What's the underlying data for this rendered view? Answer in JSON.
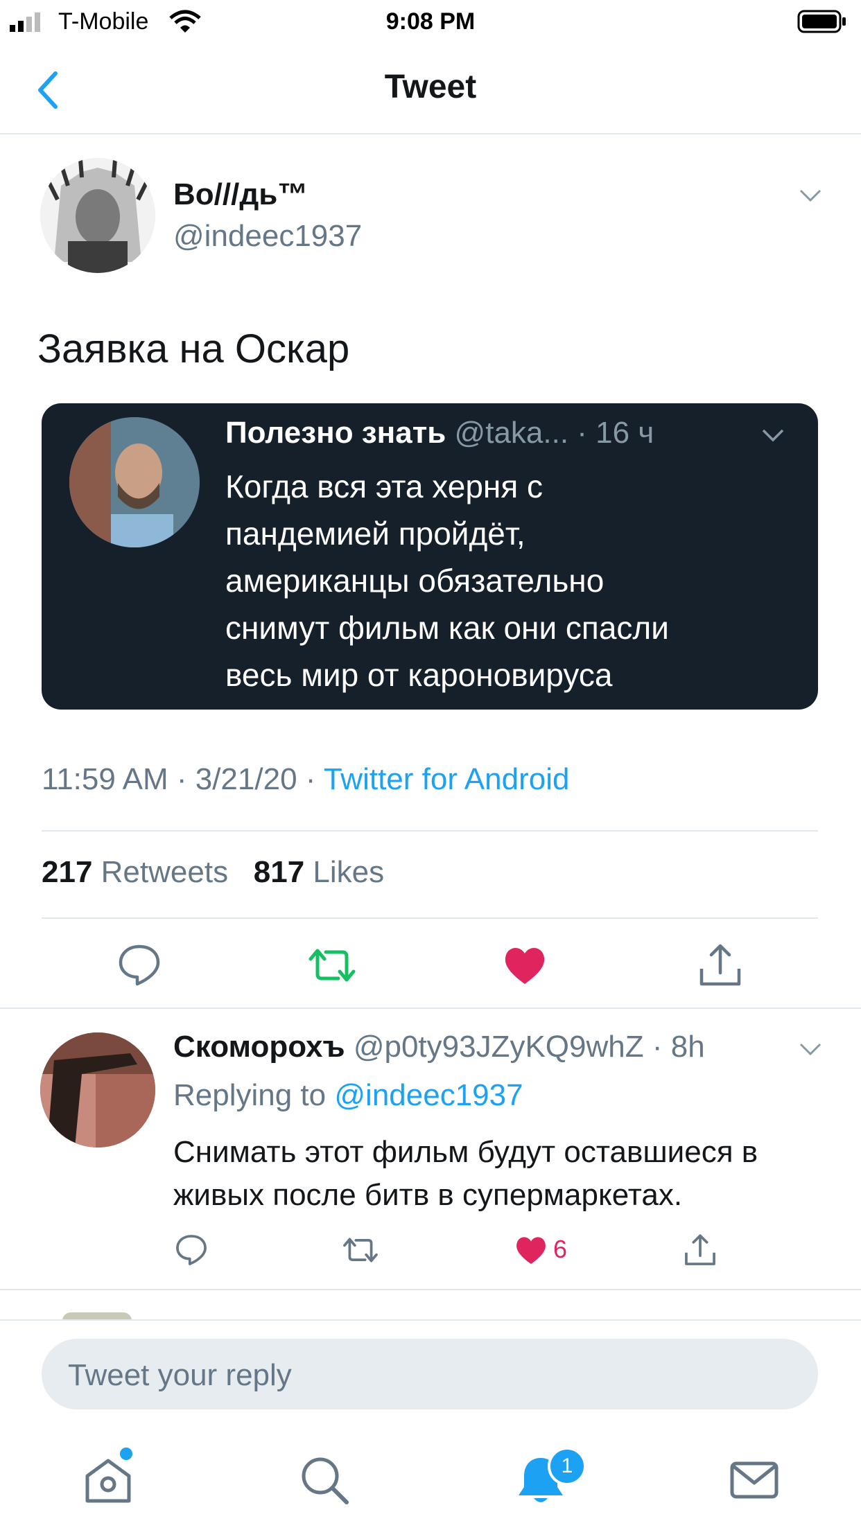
{
  "status_bar": {
    "carrier": "T-Mobile",
    "time": "9:08 PM"
  },
  "nav": {
    "title": "Tweet"
  },
  "tweet": {
    "author_name": "Во///дь™",
    "author_handle": "@indeec1937",
    "text": "Заявка на Оскар",
    "quoted": {
      "name": "Полезно знать",
      "handle": "@taka...",
      "time": "· 16 ч",
      "text": "Когда вся эта херня с\nпандемией пройдёт,\nамериканцы обязательно\nснимут фильм как они спасли\nвесь мир от кароновируса"
    },
    "timestamp": "11:59 AM · 3/21/20 · ",
    "source": "Twitter for Android",
    "retweets_count": "217",
    "retweets_label": "Retweets",
    "likes_count": "817",
    "likes_label": "Likes"
  },
  "reply": {
    "name": "Скоморохъ",
    "handle": "@p0ty93JZyKQ9whZ · 8h",
    "replying_prefix": "Replying to",
    "replying_to": "@indeec1937",
    "text": "Снимать этот фильм будут оставшиеся в живых после битв в супермаркетах.",
    "like_count": "6"
  },
  "composer": {
    "placeholder": "Tweet your reply"
  },
  "tabbar": {
    "notifications_badge": "1"
  },
  "colors": {
    "accent": "#1da1f2",
    "like": "#e0245e",
    "retweet": "#17bf63"
  }
}
